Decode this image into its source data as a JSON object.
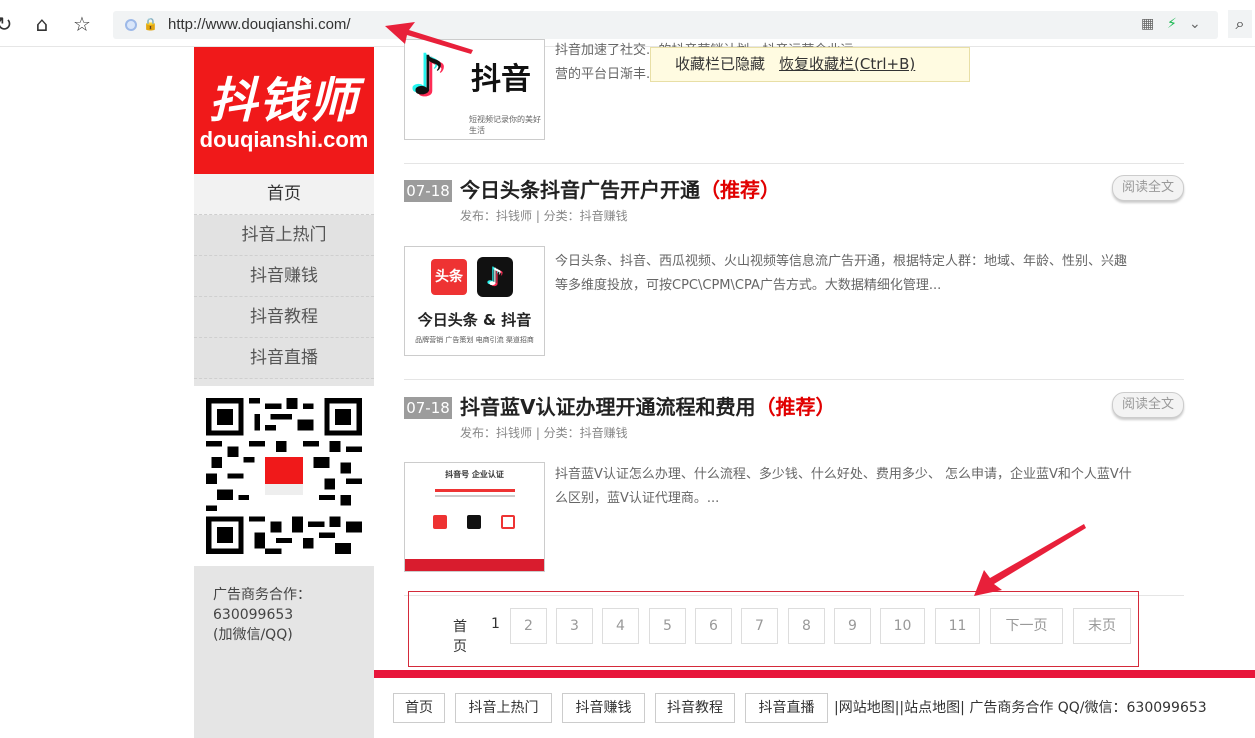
{
  "browser": {
    "url": "http://www.douqianshi.com/",
    "refresh_icon": "refresh-icon",
    "home_icon": "home-icon",
    "star_icon": "star-icon",
    "search_icon": "search-icon"
  },
  "bookmarks_notice": {
    "message": "收藏栏已隐藏",
    "restore_label": "恢复收藏栏(Ctrl+B)"
  },
  "sidebar": {
    "logo_cn": "抖钱师",
    "logo_en": "douqianshi.com",
    "nav": [
      {
        "label": "首页"
      },
      {
        "label": "抖音上热门"
      },
      {
        "label": "抖音赚钱"
      },
      {
        "label": "抖音教程"
      },
      {
        "label": "抖音直播"
      }
    ],
    "contact": {
      "line1": "广告商务合作：",
      "line2": "630099653",
      "line3": "(加微信/QQ)"
    }
  },
  "articles": [
    {
      "thumb_title": "抖音",
      "thumb_caption": "短视频记录你的美好生活",
      "summary_line1": "抖音加速了社交...的抖音营销计划。抖音运营企业运",
      "summary_line2": "营的平台日渐丰...新媒体矩阵让信息高效扩..."
    },
    {
      "date": "07-18",
      "title": "今日头条抖音广告开户开通",
      "recommend": "（推荐）",
      "meta": "发布：抖钱师 | 分类：抖音赚钱",
      "read_label": "阅读全文",
      "thumb_badge": "头条",
      "thumb_title": "今日头条 & 抖音",
      "thumb_caption": "品牌营销  广告策划  电商引流  渠道招商",
      "summary_line1": "今日头条、抖音、西瓜视频、火山视频等信息流广告开通，根据特定人群：地域、年龄、性别、兴趣",
      "summary_line2": "等多维度投放，可按CPC\\CPM\\CPA广告方式。大数据精细化管理..."
    },
    {
      "date": "07-18",
      "title": "抖音蓝V认证办理开通流程和费用",
      "recommend": "（推荐）",
      "meta": "发布：抖钱师 | 分类：抖音赚钱",
      "read_label": "阅读全文",
      "thumb_title": "抖音号 企业认证",
      "summary_line1": "抖音蓝V认证怎么办理、什么流程、多少钱、什么好处、费用多少、 怎么申请，企业蓝V和个人蓝V什",
      "summary_line2": "么区别，蓝V认证代理商。..."
    }
  ],
  "pagination": {
    "first": "首页",
    "current": "1",
    "pages": [
      "2",
      "3",
      "4",
      "5",
      "6",
      "7",
      "8",
      "9",
      "10",
      "11"
    ],
    "next": "下一页",
    "last": "末页"
  },
  "footer": {
    "links": [
      "首页",
      "抖音上热门",
      "抖音赚钱",
      "抖音教程",
      "抖音直播"
    ],
    "text": "|网站地图||站点地图| 广告商务合作 QQ/微信：630099653"
  },
  "colors": {
    "brand_red": "#f0191a",
    "recommend_red": "#e10000",
    "footer_red": "#e8163b"
  }
}
